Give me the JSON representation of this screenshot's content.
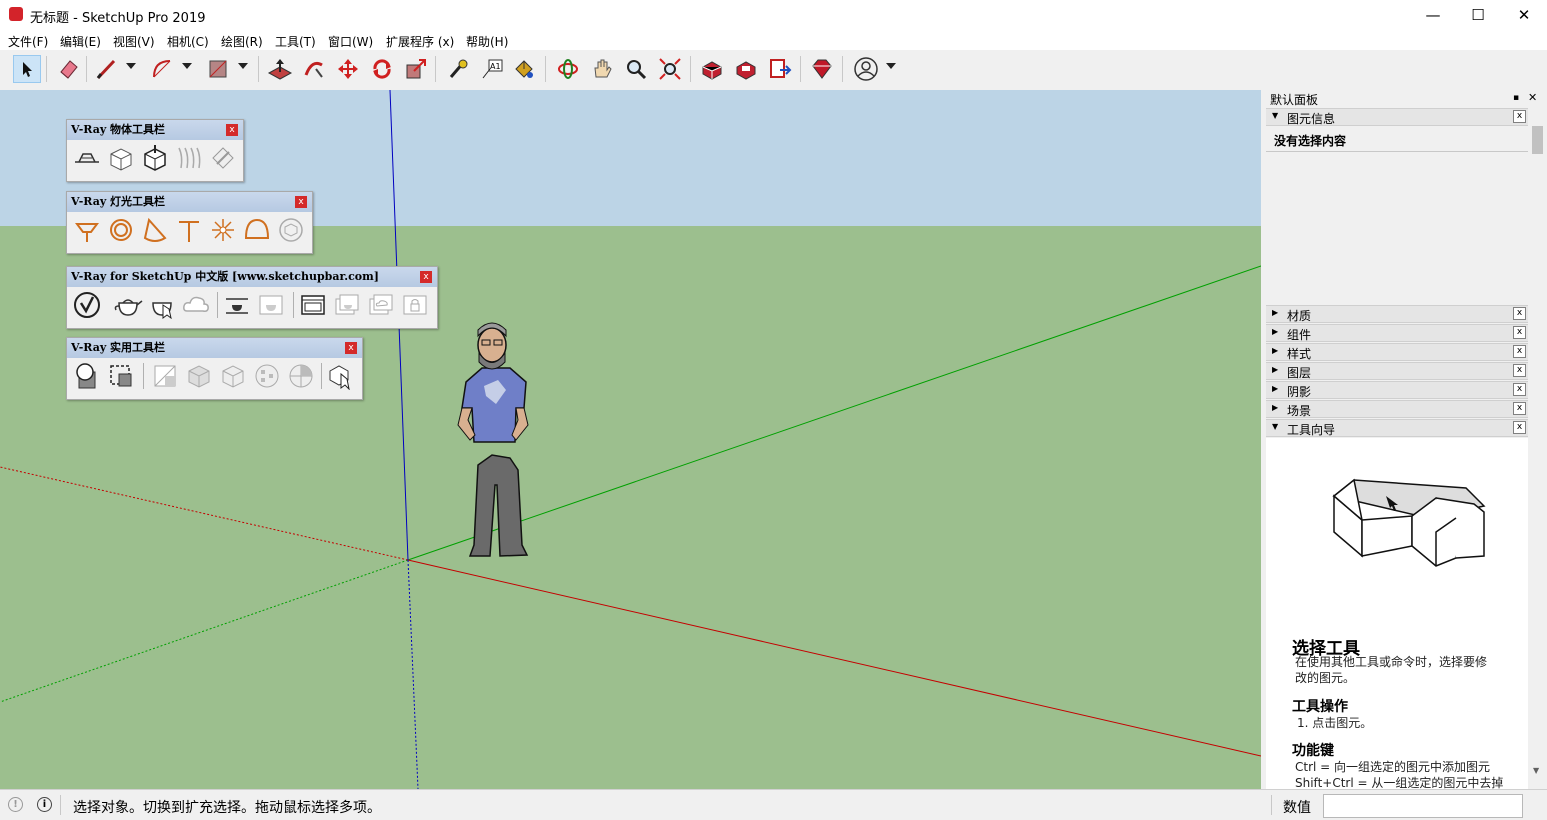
{
  "window": {
    "title": "无标题 - SketchUp Pro 2019",
    "controls": [
      "—",
      "☐",
      "✕"
    ]
  },
  "menu": [
    "文件(F)",
    "编辑(E)",
    "视图(V)",
    "相机(C)",
    "绘图(R)",
    "工具(T)",
    "窗口(W)",
    "扩展程序 (x)",
    "帮助(H)"
  ],
  "toolbar": {
    "icons": [
      "select-tool",
      "eraser-tool",
      "line-tool",
      "arc-tool",
      "rectangle-tool",
      "push-pull-tool",
      "follow-me-tool",
      "move-tool",
      "rotate-tool",
      "scale-tool",
      "tape-measure-tool",
      "text-tool",
      "paint-bucket-tool",
      "orbit-tool",
      "pan-tool",
      "zoom-tool",
      "zoom-extents-tool",
      "warehouse",
      "extension-warehouse",
      "send-to-layout",
      "extension-manager",
      "account"
    ]
  },
  "vray_windows": [
    {
      "title": "V-Ray 物体工具栏"
    },
    {
      "title": "V-Ray 灯光工具栏"
    },
    {
      "title": "V-Ray for SketchUp 中文版 [www.sketchupbar.com]"
    },
    {
      "title": "V-Ray 实用工具栏"
    }
  ],
  "panel": {
    "title": "默认面板",
    "pin": "▪",
    "close": "✕",
    "entity_info": {
      "label": "图元信息",
      "value": "没有选择内容"
    },
    "sections": [
      "材质",
      "组件",
      "样式",
      "图层",
      "阴影",
      "场景"
    ],
    "instructor": {
      "label": "工具向导",
      "tool_title": "选择工具",
      "desc_line1": "在使用其他工具或命令时，选择要修",
      "desc_line2": "改的图元。",
      "op_title": "工具操作",
      "op_text": "1. 点击图元。",
      "keys_title": "功能键",
      "key1": "Ctrl = 向一组选定的图元中添加图元",
      "key2": "Shift+Ctrl = 从一组选定的图元中去掉"
    }
  },
  "status": {
    "text": "选择对象。切换到扩充选择。拖动鼠标选择多项。",
    "value_label": "数值",
    "value": ""
  },
  "colors": {
    "sky": "#bcd4e6",
    "ground": "#9cbf8e",
    "red_axis": "#c40000",
    "green_axis": "#00a000",
    "blue_axis": "#0000c0"
  }
}
